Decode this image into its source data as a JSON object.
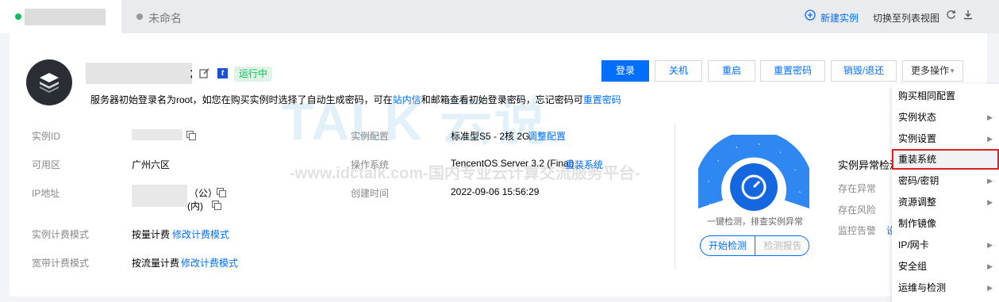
{
  "tabs": {
    "tab2_label": "未命名",
    "dot_active": "#0abf5b",
    "dot_inactive": "#999999"
  },
  "topbar": {
    "new_instance": "新建实例",
    "switch_view": "切换至列表视图"
  },
  "header": {
    "name_suffix": ";",
    "status": "运行中",
    "note_prefix": "服务器初始登录名为root，如您在购买实例时选择了自动生成密码，可在",
    "note_link1": "站内信",
    "note_middle": "和邮箱查看初始登录密码，忘记密码可",
    "note_link2": "重置密码"
  },
  "actions": {
    "login": "登录",
    "shutdown": "关机",
    "restart": "重启",
    "reset_password": "重置密码",
    "destroy": "销毁/退还",
    "more": "更多操作"
  },
  "info_left": {
    "instance_id_label": "实例ID",
    "zone_label": "可用区",
    "zone_value": "广州六区",
    "ip_label": "IP地址",
    "ip_public_suffix": "（公）",
    "ip_private_suffix": "(内)",
    "billing_label": "实例计费模式",
    "billing_value": "按量计费",
    "billing_link": "修改计费模式",
    "bandwidth_label": "宽带计费模式",
    "bandwidth_value": "按流量计费",
    "bandwidth_link": "修改计费模式"
  },
  "info_mid": {
    "config_label": "实例配置",
    "config_value": "标准型S5 - 2核 2G",
    "config_link": "调整配置",
    "os_label": "操作系统",
    "os_value": "TencentOS Server 3.2 (Final)",
    "os_link": "重装系统",
    "created_label": "创建时间",
    "created_value": "2022-09-06 15:56:29"
  },
  "check": {
    "caption": "一键检测，排查实例异常",
    "start": "开始检测",
    "report": "检测报告"
  },
  "anomaly": {
    "title": "实例异常检测",
    "row1": "存在异常",
    "row2": "存在风险",
    "row3": "监控告警",
    "row3_link": "设"
  },
  "more_menu": [
    {
      "label": "购买相同配置",
      "arrow": false
    },
    {
      "label": "实例状态",
      "arrow": true
    },
    {
      "label": "实例设置",
      "arrow": true
    },
    {
      "label": "重装系统",
      "arrow": false
    },
    {
      "label": "密码/密钥",
      "arrow": true
    },
    {
      "label": "资源调整",
      "arrow": true
    },
    {
      "label": "制作镜像",
      "arrow": false
    },
    {
      "label": "IP/网卡",
      "arrow": true
    },
    {
      "label": "安全组",
      "arrow": true
    },
    {
      "label": "运维与检测",
      "arrow": true
    }
  ],
  "watermark": {
    "brand": "TALK 云说",
    "url": "-www.idctalk.com-国内专业云计算交流服务平台-"
  },
  "colors": {
    "accent": "#006eff",
    "success": "#0abf5b",
    "highlight_border": "#e02020"
  }
}
